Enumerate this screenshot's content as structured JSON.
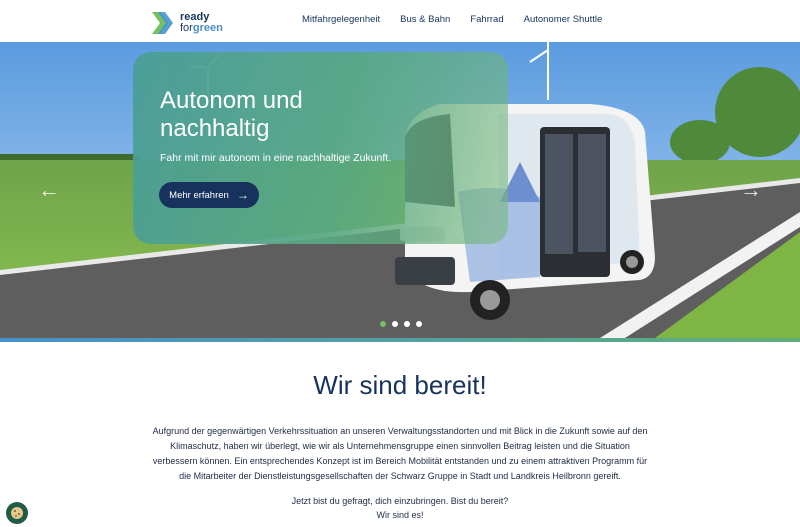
{
  "logo": {
    "line1": "ready",
    "line2_a": "for",
    "line2_b": "green"
  },
  "nav": [
    "Mitfahrgelegenheit",
    "Bus & Bahn",
    "Fahrrad",
    "Autonomer Shuttle"
  ],
  "hero": {
    "title": "Autonom und nachhaltig",
    "subtitle": "Fahr mit mir autonom in eine nachhaltige Zukunft.",
    "button_label": "Mehr erfahren",
    "slides_total": 4,
    "active_slide": 1
  },
  "section": {
    "title": "Wir sind bereit!",
    "paragraph": "Aufgrund der gegenwärtigen Verkehrssituation an unseren Verwaltungsstandorten und mit Blick in die Zukunft sowie auf den Klimaschutz, haben wir überlegt, wie wir als Unternehmensgruppe einen sinnvollen Beitrag leisten und die Situation verbessern können. Ein entsprechendes Konzept ist im Bereich Mobilität entstanden und zu einem attraktiven Programm für die Mitarbeiter der Dienstleistungsgesellschaften der Schwarz Gruppe in Stadt und Landkreis Heilbronn gereift.",
    "line1": "Jetzt bist du gefragt, dich einzubringen. Bist du bereit?",
    "line2": "Wir sind es!"
  },
  "colors": {
    "navy": "#17335d",
    "accent_green": "#76c063",
    "accent_blue": "#4a90c8"
  }
}
